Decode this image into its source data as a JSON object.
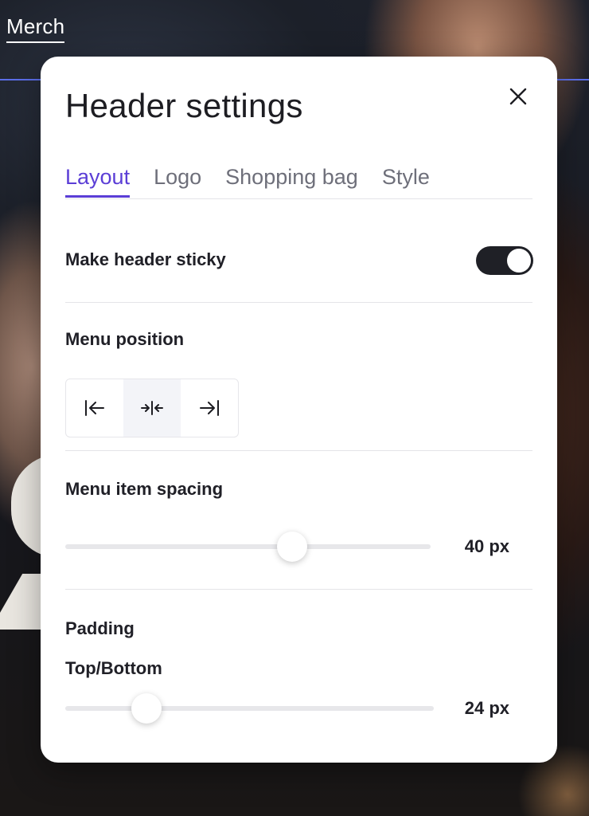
{
  "background": {
    "nav_link": "Merch"
  },
  "dialog": {
    "title": "Header settings",
    "close_icon": "close-icon",
    "tabs": [
      {
        "label": "Layout",
        "active": true
      },
      {
        "label": "Logo",
        "active": false
      },
      {
        "label": "Shopping bag",
        "active": false
      },
      {
        "label": "Style",
        "active": false
      }
    ],
    "sticky": {
      "label": "Make header sticky",
      "enabled": true
    },
    "menu_position": {
      "label": "Menu position",
      "options": [
        {
          "icon": "align-left-icon",
          "selected": false
        },
        {
          "icon": "align-center-icon",
          "selected": true
        },
        {
          "icon": "align-right-icon",
          "selected": false
        }
      ]
    },
    "menu_item_spacing": {
      "label": "Menu item spacing",
      "value": "40 px",
      "fraction": 0.62
    },
    "padding": {
      "label": "Padding",
      "top_bottom": {
        "label": "Top/Bottom",
        "value": "24 px",
        "fraction": 0.22
      }
    }
  },
  "colors": {
    "accent": "#5b3ed6",
    "toggle_on": "#1f2026",
    "nav_underline": "#5b6ee8"
  }
}
